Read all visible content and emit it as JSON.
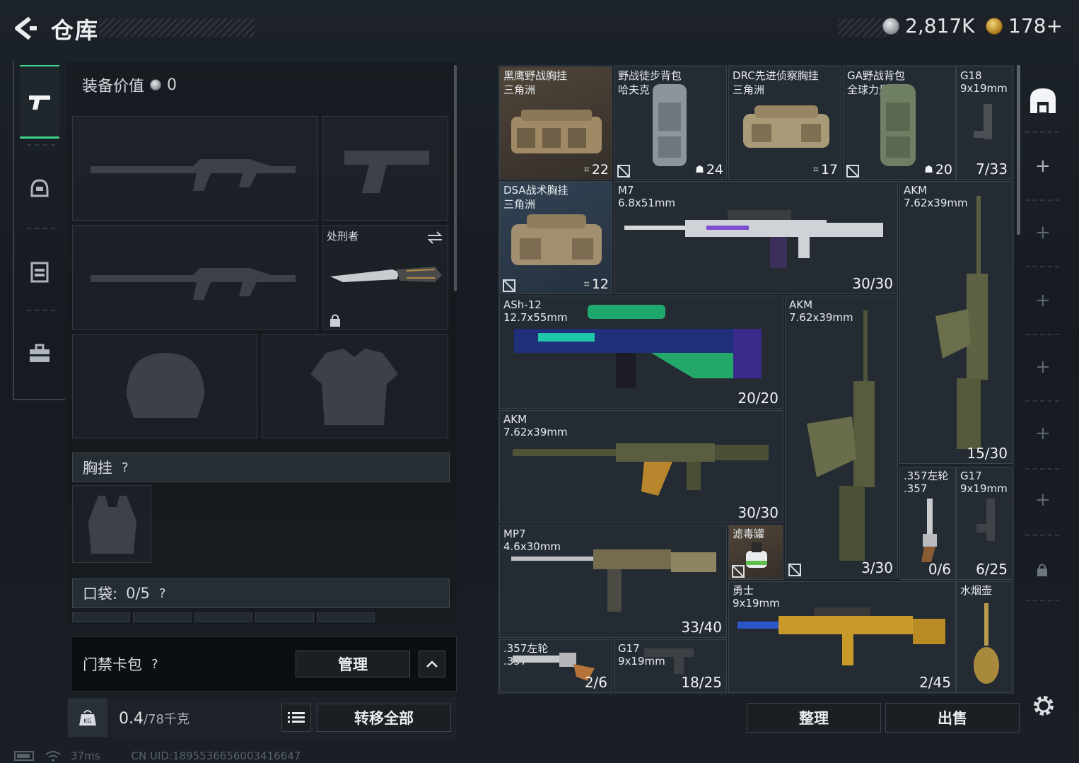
{
  "header": {
    "title": "仓库",
    "silver_amount": "2,817K",
    "gold_amount": "178+"
  },
  "sidenav": {
    "items": [
      {
        "icon": "gun-icon",
        "active": true
      },
      {
        "icon": "helmet-icon",
        "active": false
      },
      {
        "icon": "vest-icon",
        "active": false
      },
      {
        "icon": "briefcase-icon",
        "active": false
      }
    ]
  },
  "equipment": {
    "value_label": "装备价值",
    "value": "0",
    "melee_label": "处刑者",
    "chest_rig_label": "胸挂",
    "pocket_label": "口袋:",
    "pocket_count": "0/5",
    "help_mark": "?",
    "keycard_label": "门禁卡包",
    "manage_label": "管理",
    "weight_value": "0.4",
    "weight_capacity": "/78千克",
    "transfer_all_label": "转移全部"
  },
  "storage": {
    "items": [
      {
        "name": "黑鹰野战胸挂",
        "sub": "三角洲",
        "stat": "22",
        "stat_icon": "chest-icon",
        "nosign": true
      },
      {
        "name": "野战徒步背包",
        "sub": "哈夫克",
        "stat": "24",
        "stat_icon": "bag-icon"
      },
      {
        "name": "DRC先进侦察胸挂",
        "sub": "三角洲",
        "stat": "17",
        "stat_icon": "chest-icon",
        "nosign": true
      },
      {
        "name": "GA野战背包",
        "sub": "全球力量",
        "stat": "20",
        "stat_icon": "bag-icon"
      },
      {
        "name": "G18",
        "sub": "9x19mm",
        "count": "7/33"
      },
      {
        "name": "DSA战术胸挂",
        "sub": "三角洲",
        "stat": "12",
        "stat_icon": "chest-icon",
        "nosign": true
      },
      {
        "name": "M7",
        "sub": "6.8x51mm",
        "count": "30/30"
      },
      {
        "name": "AKM",
        "sub": "7.62x39mm",
        "count": "15/30"
      },
      {
        "name": "ASh-12",
        "sub": "12.7x55mm",
        "count": "20/20"
      },
      {
        "name": "AKM",
        "sub": "7.62x39mm",
        "count": "3/30"
      },
      {
        "name": "AKM",
        "sub": "7.62x39mm",
        "count": "30/30"
      },
      {
        "name": ".357左轮",
        "sub": ".357",
        "count": "0/6"
      },
      {
        "name": "G17",
        "sub": "9x19mm",
        "count": "6/25"
      },
      {
        "name": "MP7",
        "sub": "4.6x30mm",
        "count": "33/40"
      },
      {
        "name": "滤毒罐",
        "sub": ""
      },
      {
        "name": "勇士",
        "sub": "9x19mm",
        "count": "2/45"
      },
      {
        "name": "水烟壶",
        "sub": ""
      },
      {
        "name": ".357左轮",
        "sub": ".357",
        "count": "2/6"
      },
      {
        "name": "G17",
        "sub": "9x19mm",
        "count": "18/25"
      }
    ],
    "sort_label": "整理",
    "sell_label": "出售"
  },
  "footer": {
    "ping": "37ms",
    "uid": "CN UID:1895536656003416647"
  },
  "colors": {
    "accent_green": "#3fd28a",
    "background": "#181d23"
  }
}
